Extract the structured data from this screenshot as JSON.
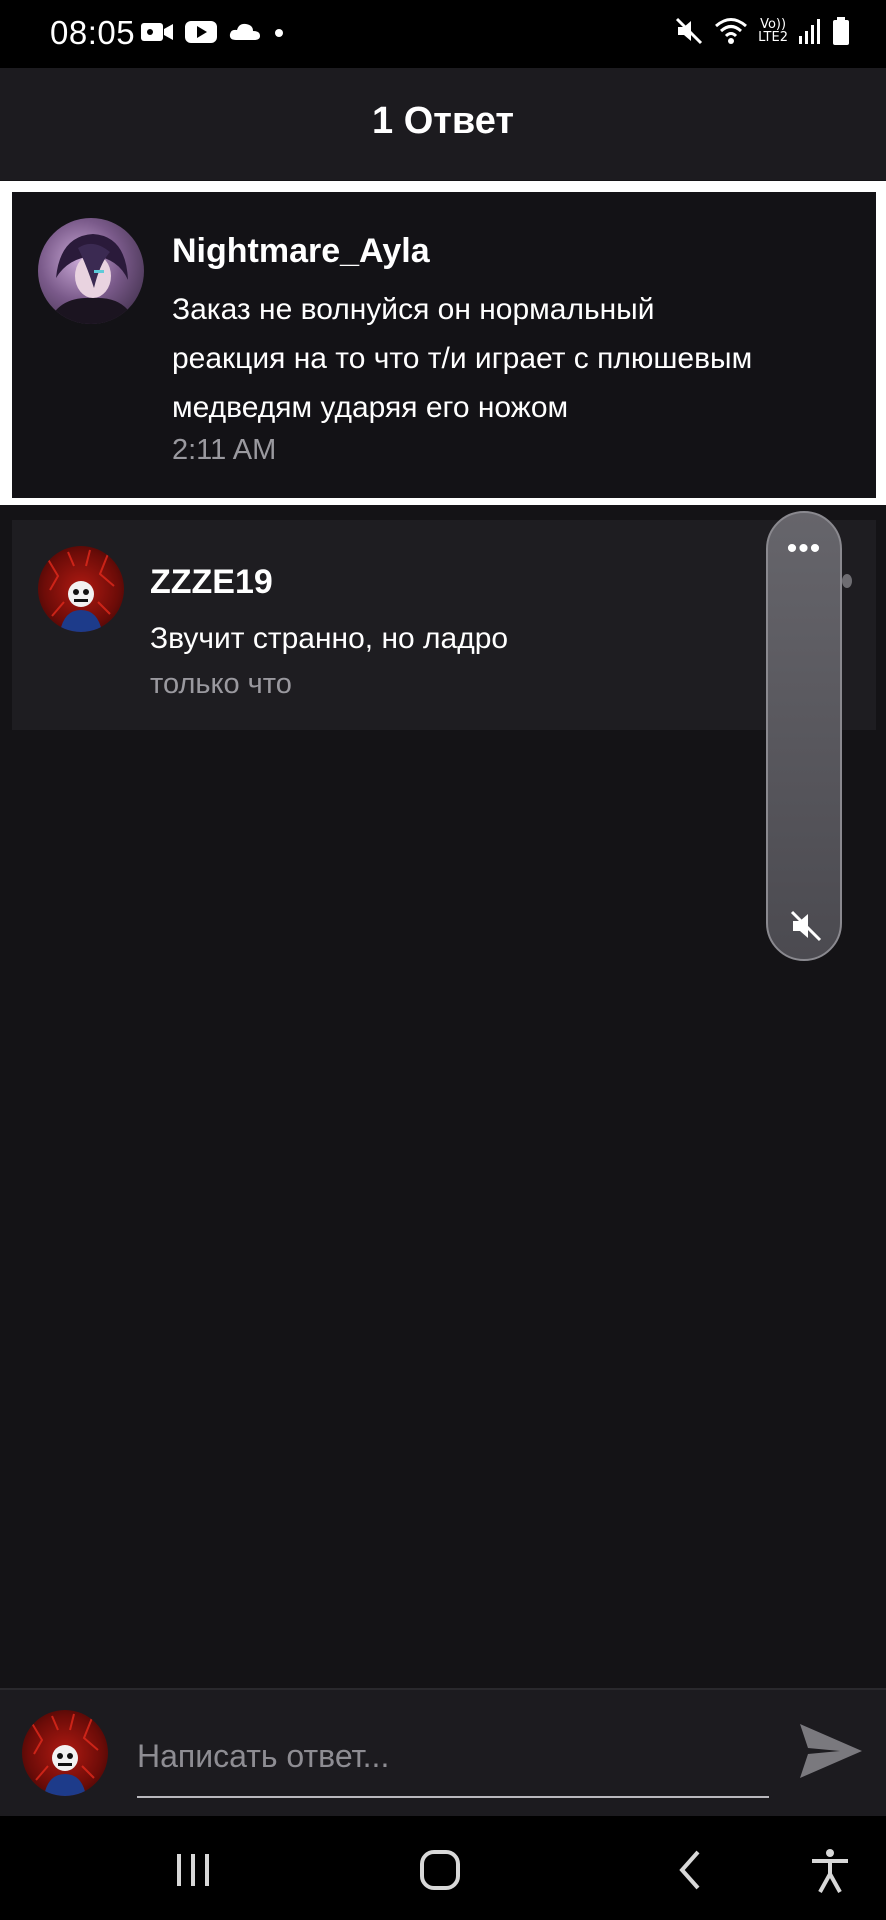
{
  "status_bar": {
    "time": "08:05",
    "lte_top": "Vo))",
    "lte_bottom": "LTE2",
    "left_icons": [
      "video-camera-icon",
      "youtube-icon",
      "cloud-icon",
      "dot-icon"
    ],
    "right_icons": [
      "mute-icon",
      "wifi-icon",
      "lte-icon",
      "signal-icon",
      "battery-icon"
    ]
  },
  "header": {
    "title": "1 Ответ"
  },
  "original_comment": {
    "author": "Nightmare_Ayla",
    "lines": [
      "Заказ не волнуйся он нормальный",
      "реакция на то что т/и играет с плюшевым",
      "медведям ударяя его ножом"
    ],
    "time": "2:11 AM"
  },
  "reply": {
    "author": "ZZZE19",
    "text": "Звучит странно, но ладро",
    "time": "только что"
  },
  "floating_pill": {
    "menu_glyph": "•••",
    "icons": [
      "more-dots-icon",
      "mute-icon"
    ]
  },
  "composer": {
    "placeholder": "Написать ответ...",
    "value": "",
    "send_icon": "send-icon"
  },
  "nav_bar": {
    "icons": [
      "recent-apps-icon",
      "home-icon",
      "back-icon",
      "accessibility-icon"
    ]
  },
  "colors": {
    "background": "#141316",
    "header": "#1c1b1f",
    "highlight_border": "#ffffff",
    "reply_card": "#1e1d21",
    "muted_text": "#9a999f"
  }
}
